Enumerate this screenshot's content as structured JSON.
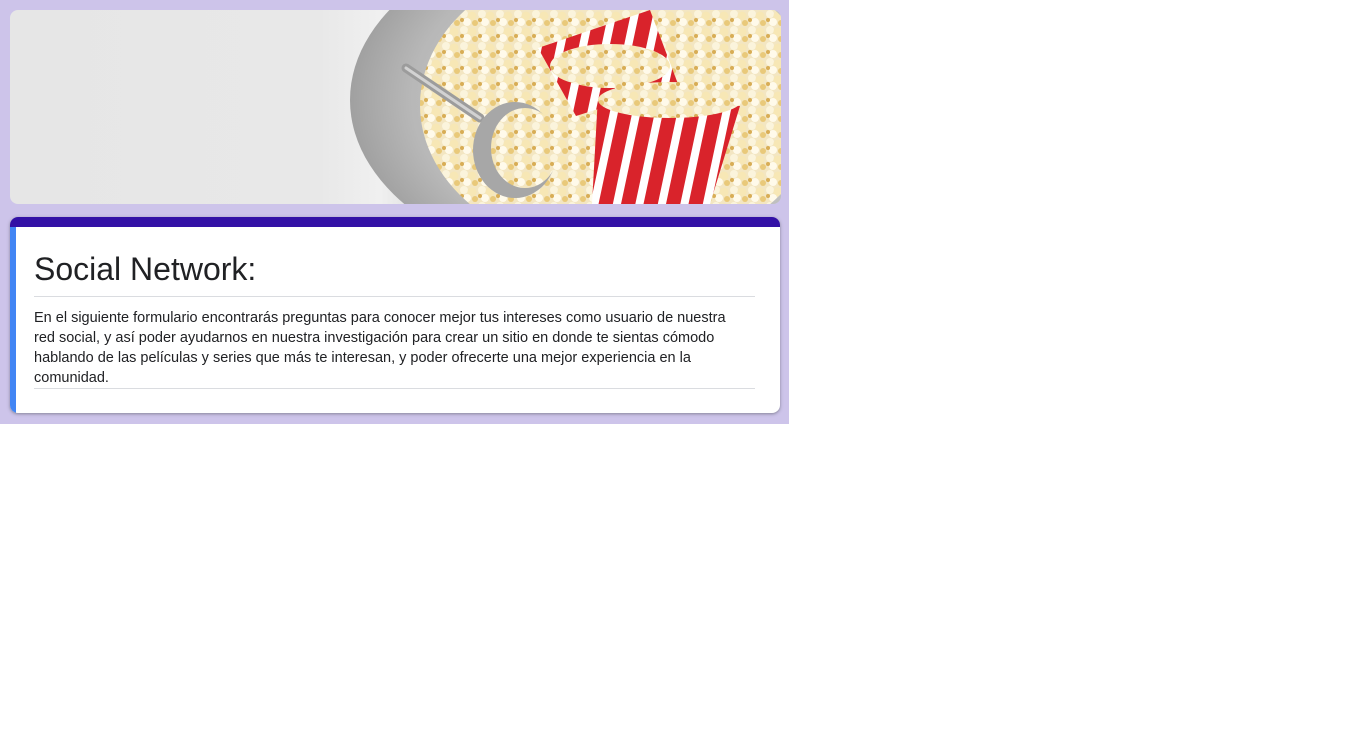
{
  "theme": {
    "page_background": "#cdc4ea",
    "accent_top": "#3311a6",
    "accent_left": "#4285f4"
  },
  "header": {
    "image_icon": "popcorn-banner-image"
  },
  "form": {
    "title": "Social Network:",
    "description": "En el siguiente formulario encontrarás preguntas para conocer mejor tus intereses como usuario de nuestra red social, y así poder ayudarnos en nuestra investigación para crear un sitio en donde te sientas cómodo hablando de las películas y series que más te interesan, y poder ofrecerte una mejor experiencia en la comunidad."
  }
}
